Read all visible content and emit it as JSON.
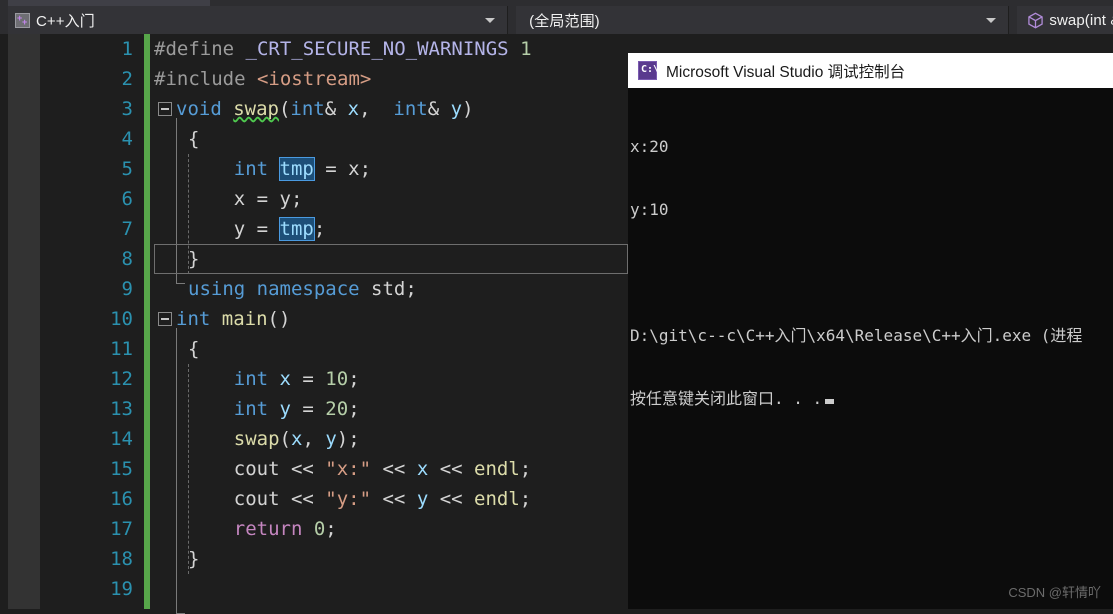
{
  "navbar": {
    "project": {
      "label": "C++入门",
      "icon": "cpp-file-icon",
      "arrow": "chevron-down-icon"
    },
    "scope": {
      "label": "(全局范围)",
      "arrow": "chevron-down-icon"
    },
    "member": {
      "label": "swap(int &",
      "icon": "cube-icon"
    }
  },
  "editor": {
    "line_numbers": [
      "1",
      "2",
      "3",
      "4",
      "5",
      "6",
      "7",
      "8",
      "9",
      "10",
      "11",
      "12",
      "13",
      "14",
      "15",
      "16",
      "17",
      "18",
      "19"
    ],
    "current_line": 7,
    "lines": [
      {
        "n": "1",
        "text": "#define _CRT_SECURE_NO_WARNINGS 1"
      },
      {
        "n": "2",
        "text": "#include <iostream>"
      },
      {
        "n": "3",
        "text": "void swap(int& x, int& y)"
      },
      {
        "n": "4",
        "text": "{"
      },
      {
        "n": "5",
        "text": "    int tmp = x;"
      },
      {
        "n": "6",
        "text": "    x = y;"
      },
      {
        "n": "7",
        "text": "    y = tmp;"
      },
      {
        "n": "8",
        "text": "}"
      },
      {
        "n": "9",
        "text": "using namespace std;"
      },
      {
        "n": "10",
        "text": "int main()"
      },
      {
        "n": "11",
        "text": "{"
      },
      {
        "n": "12",
        "text": "    int x = 10;"
      },
      {
        "n": "13",
        "text": "    int y = 20;"
      },
      {
        "n": "14",
        "text": "    swap(x, y);"
      },
      {
        "n": "15",
        "text": "    cout << \"x:\" << x << endl;"
      },
      {
        "n": "16",
        "text": "    cout << \"y:\" << y << endl;"
      },
      {
        "n": "17",
        "text": "    return 0;"
      },
      {
        "n": "18",
        "text": "}"
      },
      {
        "n": "19",
        "text": ""
      }
    ],
    "tokens": {
      "l1_define": "#define ",
      "l1_macro": "_CRT_SECURE_NO_WARNINGS",
      "l1_value": " 1",
      "l2_include": "#include ",
      "l2_header": "<iostream>",
      "l3_void": "void ",
      "l3_swap": "swap",
      "l3_open": "(",
      "l3_int1": "int",
      "l3_amp1": "& ",
      "l3_x": "x",
      "l3_comma": ",  ",
      "l3_int2": "int",
      "l3_amp2": "& ",
      "l3_y": "y",
      "l3_close": ")",
      "l4_brace": "{",
      "l5_indent": "    ",
      "l5_int": "int ",
      "l5_tmp": "tmp",
      "l5_rest": " = x;",
      "l6_text": "    x = y;",
      "l7_indent": "    ",
      "l7_lhs": "y = ",
      "l7_tmp": "tmp",
      "l7_semi": ";",
      "l8_brace": "}",
      "l9_using": "using namespace ",
      "l9_std": "std;",
      "l10_int": "int ",
      "l10_main": "main",
      "l10_parens": "()",
      "l11_brace": "{",
      "l12_int": "    int ",
      "l12_x": "x",
      "l12_eq": " = ",
      "l12_num": "10",
      "l12_semi": ";",
      "l13_int": "    int ",
      "l13_y": "y",
      "l13_eq": " = ",
      "l13_num": "20",
      "l13_semi": ";",
      "l14_indent": "    ",
      "l14_swap": "swap",
      "l14_open": "(",
      "l14_x": "x",
      "l14_comma": ", ",
      "l14_y": "y",
      "l14_close": ");",
      "l15_cout": "    cout << ",
      "l15_str": "\"x:\"",
      "l15_mid": " << ",
      "l15_var": "x",
      "l15_mid2": " << ",
      "l15_endl": "endl",
      "l15_semi": ";",
      "l16_cout": "    cout << ",
      "l16_str": "\"y:\"",
      "l16_mid": " << ",
      "l16_var": "y",
      "l16_mid2": " << ",
      "l16_endl": "endl",
      "l16_semi": ";",
      "l17_indent": "    ",
      "l17_return": "return ",
      "l17_num": "0",
      "l17_semi": ";",
      "l18_brace": "}"
    }
  },
  "console": {
    "title": "Microsoft Visual Studio 调试控制台",
    "icon": "cmd-prompt-icon",
    "output_lines": [
      "x:20",
      "y:10",
      "",
      "D:\\git\\c--c\\C++入门\\x64\\Release\\C++入门.exe (进程",
      "按任意键关闭此窗口. . ."
    ]
  },
  "watermark": {
    "text": "CSDN @轩情吖"
  },
  "colors": {
    "editor_bg": "#1e1e1e",
    "gutter_bg": "#333333",
    "change_bar": "#57a64a",
    "navbar_bg": "#2d2d30",
    "nav_cell_bg": "#333337",
    "console_bg": "#0c0c0c",
    "console_title_bg": "#ffffff",
    "line_number": "#2b91af",
    "keyword": "#569cd6",
    "function": "#dcdcaa",
    "string": "#d69d85",
    "number": "#b5cea8",
    "macro": "#b4b4e8",
    "ref_highlight": "#1d4f78"
  }
}
